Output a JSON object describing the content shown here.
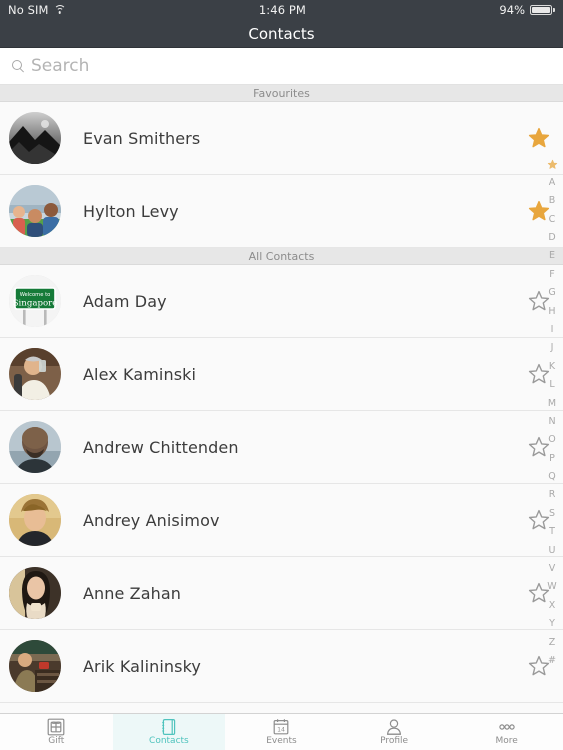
{
  "statusbar": {
    "carrier": "No SIM",
    "wifi_icon": "wifi-icon",
    "time": "1:46 PM",
    "battery_percent": "94%",
    "battery_icon": "battery-icon"
  },
  "navbar": {
    "title": "Contacts"
  },
  "search": {
    "placeholder": "Search",
    "value": "",
    "icon": "search-icon"
  },
  "sections": [
    {
      "header": "Favourites",
      "contacts": [
        {
          "name": "Evan Smithers",
          "favourite": true,
          "avatar": "photo-bw-mountain"
        },
        {
          "name": "Hylton Levy",
          "favourite": true,
          "avatar": "photo-family-beach"
        }
      ]
    },
    {
      "header": "All Contacts",
      "contacts": [
        {
          "name": "Adam Day",
          "favourite": false,
          "avatar": "photo-singapore-sign"
        },
        {
          "name": "Alex Kaminski",
          "favourite": false,
          "avatar": "photo-man-drinking"
        },
        {
          "name": "Andrew Chittenden",
          "favourite": false,
          "avatar": "photo-bald-man"
        },
        {
          "name": "Andrey Anisimov",
          "favourite": false,
          "avatar": "photo-young-man"
        },
        {
          "name": "Anne Zahan",
          "favourite": false,
          "avatar": "photo-woman-dark-hair"
        },
        {
          "name": "Arik Kalininsky",
          "favourite": false,
          "avatar": "photo-man-indoors"
        }
      ]
    }
  ],
  "index_strip": [
    "★",
    "A",
    "B",
    "C",
    "D",
    "E",
    "F",
    "G",
    "H",
    "I",
    "J",
    "K",
    "L",
    "M",
    "N",
    "O",
    "P",
    "Q",
    "R",
    "S",
    "T",
    "U",
    "V",
    "W",
    "X",
    "Y",
    "Z",
    "#"
  ],
  "tabbar": {
    "items": [
      {
        "label": "Gift",
        "icon": "gift-icon",
        "active": false
      },
      {
        "label": "Contacts",
        "icon": "contacts-icon",
        "active": true
      },
      {
        "label": "Events",
        "icon": "calendar-icon",
        "active": false
      },
      {
        "label": "Profile",
        "icon": "person-icon",
        "active": false
      },
      {
        "label": "More",
        "icon": "ellipsis-icon",
        "active": false
      }
    ]
  },
  "colors": {
    "navbar_bg": "#3b4046",
    "accent_teal": "#4fc3bd",
    "star_filled": "#e8a63d",
    "star_empty": "#9a9a9a",
    "section_bg": "#e7e7e7"
  },
  "calendar_day": "14"
}
